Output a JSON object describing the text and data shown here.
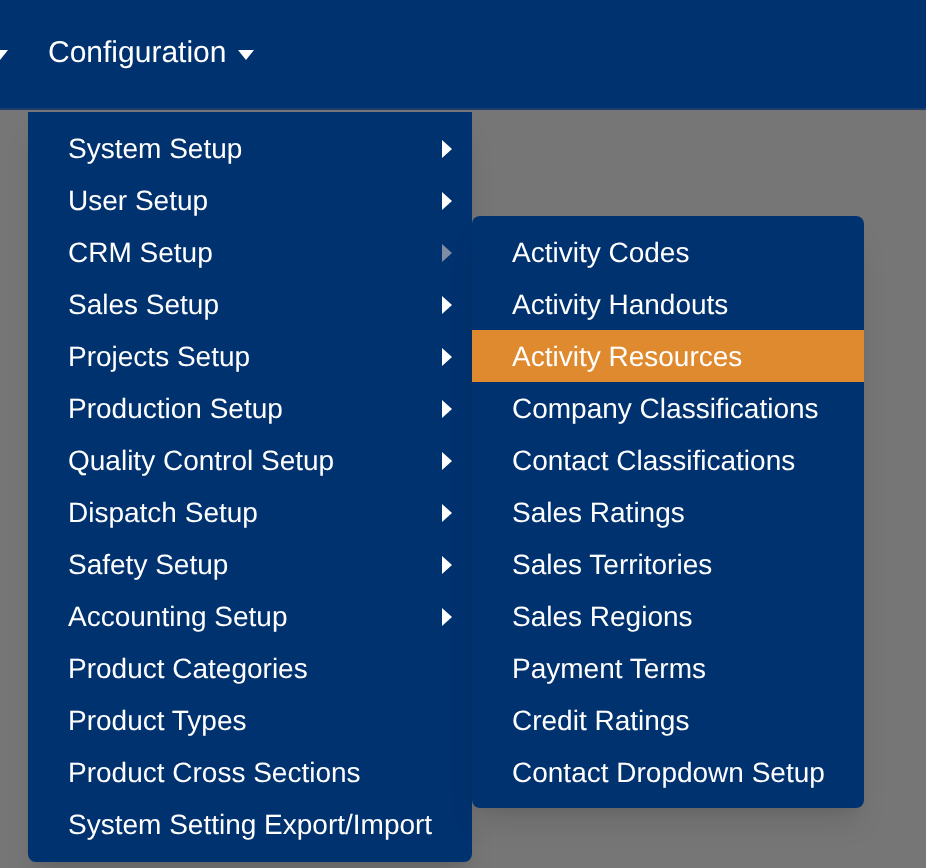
{
  "navbar": {
    "menus": [
      {
        "label": "Configuration",
        "expanded": true
      }
    ]
  },
  "menu": {
    "items": [
      {
        "label": "System Setup",
        "kind": "submenu",
        "expanded": false
      },
      {
        "label": "User Setup",
        "kind": "submenu",
        "expanded": false
      },
      {
        "label": "CRM Setup",
        "kind": "submenu",
        "expanded": true
      },
      {
        "label": "Sales Setup",
        "kind": "submenu",
        "expanded": false
      },
      {
        "label": "Projects Setup",
        "kind": "submenu",
        "expanded": false
      },
      {
        "label": "Production Setup",
        "kind": "submenu",
        "expanded": false
      },
      {
        "label": "Quality Control Setup",
        "kind": "submenu",
        "expanded": false
      },
      {
        "label": "Dispatch Setup",
        "kind": "submenu",
        "expanded": false
      },
      {
        "label": "Safety Setup",
        "kind": "submenu",
        "expanded": false
      },
      {
        "label": "Accounting Setup",
        "kind": "submenu",
        "expanded": false
      },
      {
        "label": "Product Categories",
        "kind": "link"
      },
      {
        "label": "Product Types",
        "kind": "link"
      },
      {
        "label": "Product Cross Sections",
        "kind": "link"
      },
      {
        "label": "System Setting Export/Import",
        "kind": "link"
      }
    ]
  },
  "submenu": {
    "items": [
      {
        "label": "Activity Codes",
        "selected": false
      },
      {
        "label": "Activity Handouts",
        "selected": false
      },
      {
        "label": "Activity Resources",
        "selected": true
      },
      {
        "label": "Company Classifications",
        "selected": false
      },
      {
        "label": "Contact Classifications",
        "selected": false
      },
      {
        "label": "Sales Ratings",
        "selected": false
      },
      {
        "label": "Sales Territories",
        "selected": false
      },
      {
        "label": "Sales Regions",
        "selected": false
      },
      {
        "label": "Payment Terms",
        "selected": false
      },
      {
        "label": "Credit Ratings",
        "selected": false
      },
      {
        "label": "Contact Dropdown Setup",
        "selected": false
      }
    ]
  }
}
